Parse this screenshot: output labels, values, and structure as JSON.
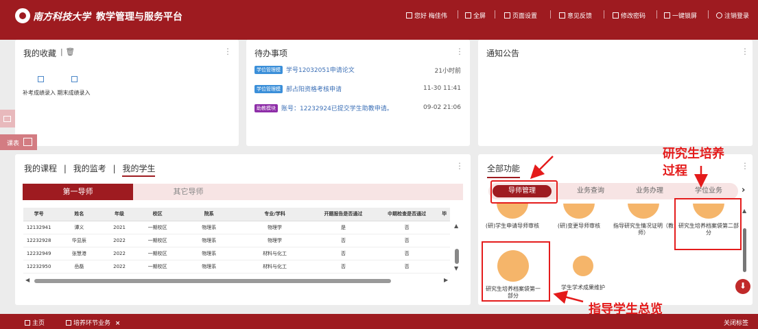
{
  "header": {
    "university": "南方科技大学",
    "system_name": "教学管理与服务平台",
    "links": [
      "您好 梅佳伟",
      "全屏",
      "页面设置",
      "意见反馈",
      "修改密码",
      "一键锁屏",
      "注销登录"
    ]
  },
  "favorites": {
    "title": "我的收藏",
    "items": [
      "补考成绩录入",
      "期末成绩录入"
    ]
  },
  "todo": {
    "title": "待办事项",
    "items": [
      {
        "tag": "学位管理模",
        "text": "学号12032051申请论文",
        "time": "21小时前",
        "color": "#3b8fd9"
      },
      {
        "tag": "学位管理模",
        "text": "郝占阳资格考核申请",
        "time": "11-30 11:41",
        "color": "#3b8fd9"
      },
      {
        "tag": "助教模块",
        "text": "账号：12232924已提交学生助教申请。",
        "time": "09-02 21:06",
        "color": "#8e2ea8"
      }
    ]
  },
  "notice": {
    "title": "通知公告"
  },
  "side": {
    "schedule_label": "课表"
  },
  "course": {
    "tabs": [
      "我的课程",
      "我的监考",
      "我的学生"
    ],
    "subtabs": [
      "第一导师",
      "其它导师"
    ],
    "columns": [
      "学号",
      "姓名",
      "年级",
      "校区",
      "院系",
      "专业/学科",
      "开题报告是否通过",
      "中期检查是否通过",
      "毕"
    ],
    "rows": [
      [
        "12132941",
        "谭义",
        "2021",
        "一期校区",
        "物理系",
        "物理学",
        "是",
        "否"
      ],
      [
        "12232928",
        "华显辰",
        "2022",
        "一期校区",
        "物理系",
        "物理学",
        "否",
        "否"
      ],
      [
        "12232949",
        "张慧港",
        "2022",
        "一期校区",
        "物理系",
        "材料与化工",
        "否",
        "否"
      ],
      [
        "12232950",
        "岳磊",
        "2022",
        "一期校区",
        "物理系",
        "材料与化工",
        "否",
        "否"
      ]
    ]
  },
  "functions": {
    "title": "全部功能",
    "tabs": [
      "导师管理",
      "业务查询",
      "业务办理",
      "学位业务"
    ],
    "items": [
      {
        "label": "(研)学生申请导师审核"
      },
      {
        "label": "(研)变更导师审核"
      },
      {
        "label": "指导研究生情况证明（教师）"
      },
      {
        "label": "研究生培养档案袋第二部分"
      },
      {
        "label": "研究生培养档案袋第一部分"
      },
      {
        "label": "学生学术成果维护"
      }
    ]
  },
  "annotations": {
    "a1": "研究生培养",
    "a2": "过程",
    "a3": "指导学生总览"
  },
  "bottom": {
    "home": "主页",
    "tab": "培养环节业务",
    "close": "关闭标签"
  },
  "colors": {
    "brand": "#9e1b20",
    "annotation": "#e41b1b",
    "icon_circle": "#f5b56a"
  }
}
